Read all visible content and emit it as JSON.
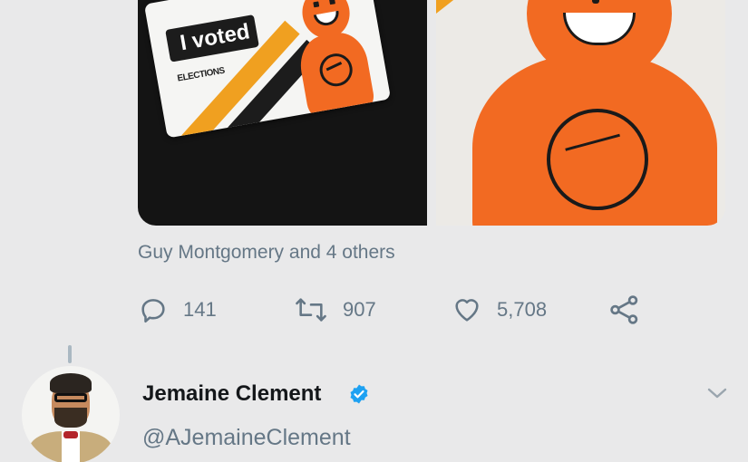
{
  "tweet": {
    "media": [
      {
        "description_icon": "i-voted-sticker-photo",
        "sticker_text": "I voted",
        "sticker_subtext": "ELECTIONS"
      },
      {
        "description_icon": "orange-figure-closeup-photo"
      }
    ],
    "likers_text": "Guy Montgomery and 4 others",
    "actions": {
      "reply_count": "141",
      "retweet_count": "907",
      "like_count": "5,708"
    }
  },
  "next_tweet": {
    "author_name": "Jemaine Clement",
    "author_handle": "@AJemaineClement",
    "verified": true
  },
  "colors": {
    "background": "#e9e9ea",
    "secondary_text": "#657786",
    "verified_blue": "#1da1f2",
    "figure_orange": "#f26a22"
  }
}
